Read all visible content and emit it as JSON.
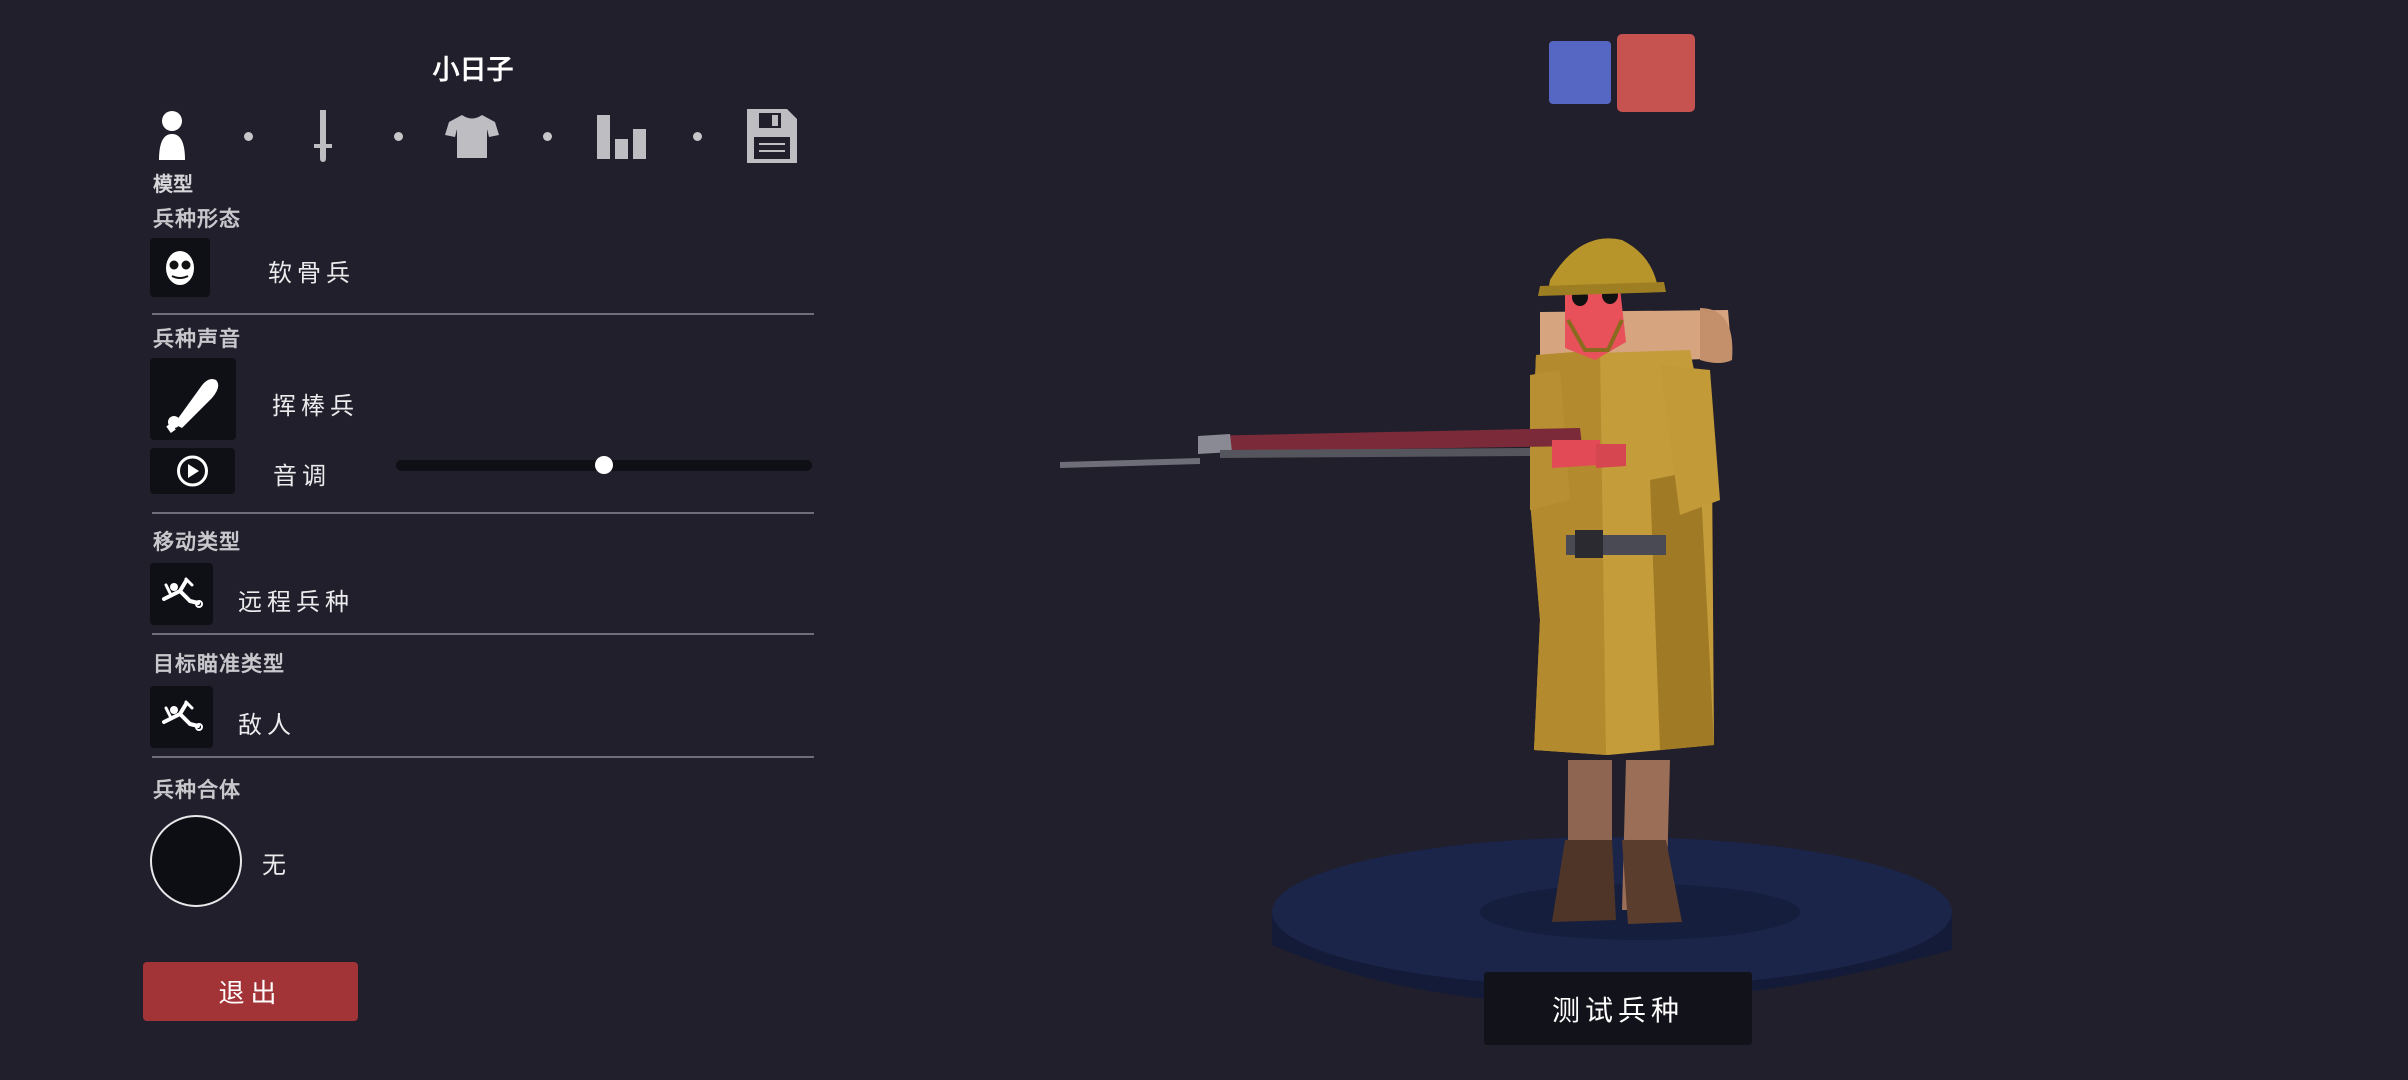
{
  "header": {
    "unit_name": "小日子"
  },
  "tabs": [
    {
      "icon": "person-icon",
      "label": "模型",
      "active": true
    },
    {
      "icon": "sword-icon",
      "active": false
    },
    {
      "icon": "shirt-icon",
      "active": false
    },
    {
      "icon": "bar-chart-icon",
      "active": false
    },
    {
      "icon": "save-disk-icon",
      "active": false
    }
  ],
  "sections": {
    "form": {
      "title": "兵种形态",
      "icon": "mask-face-icon",
      "value": "软骨兵"
    },
    "voice": {
      "title": "兵种声音",
      "icon": "club-icon",
      "value": "挥棒兵",
      "pitch_label": "音调",
      "pitch_level": 0.5,
      "play_icon": "play-icon"
    },
    "movement": {
      "title": "移动类型",
      "icon": "stickman-running-icon",
      "value": "远程兵种"
    },
    "targeting": {
      "title": "目标瞄准类型",
      "icon": "stickman-target-icon",
      "value": "敌人"
    },
    "merge": {
      "title": "兵种合体",
      "value": "无"
    }
  },
  "buttons": {
    "exit": "退出",
    "test_unit": "测试兵种"
  },
  "team_colors": {
    "blue": "#5567c2",
    "red": "#c75351"
  },
  "colors": {
    "background": "#201f2b",
    "exit_button": "#a23437",
    "panel_box": "#0f0f16"
  }
}
